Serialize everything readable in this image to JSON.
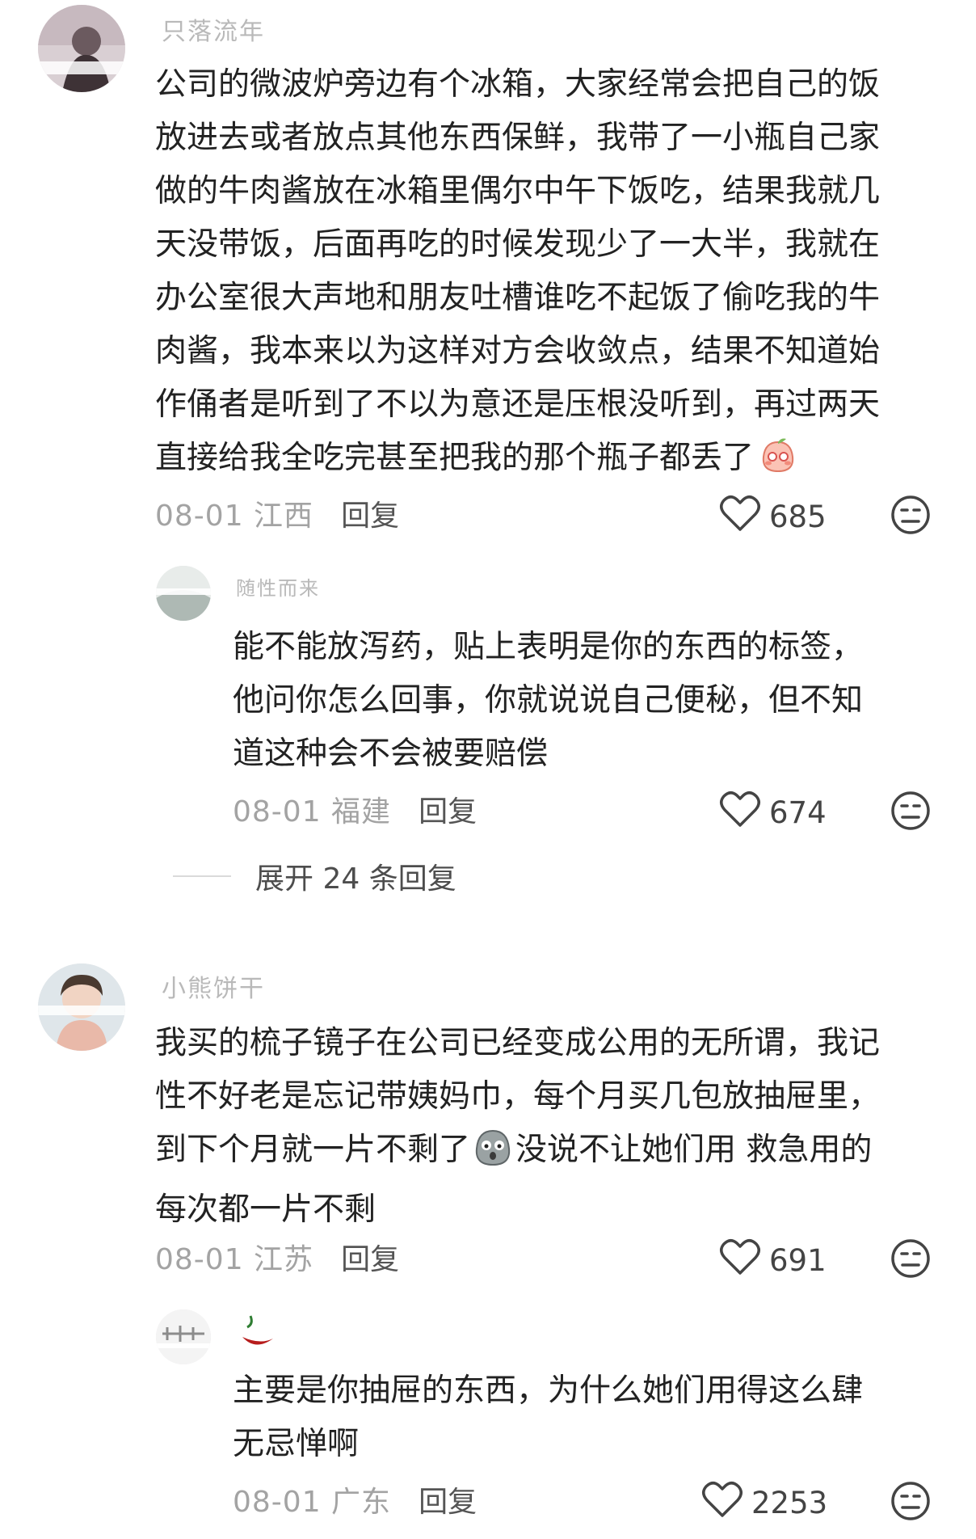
{
  "comments": [
    {
      "author": "只落流年",
      "lines": [
        "公司的微波炉旁边有个冰箱，大家经常会把自己的饭",
        "放进去或者放点其他东西保鲜，我带了一小瓶自己家",
        "做的牛肉酱放在冰箱里偶尔中午下饭吃，结果我就几",
        "天没带饭，后面再吃的时候发现少了一大半，我就在",
        "办公室很大声地和朋友吐槽谁吃不起饭了偷吃我的牛",
        "肉酱，我本来以为这样对方会收敛点，结果不知道始",
        "作俑者是听到了不以为意还是压根没听到，再过两天",
        "直接给我全吃完甚至把我的那个瓶子都丢了"
      ],
      "date_location": "08-01 江西",
      "reply_label": "回复",
      "likes": "685"
    },
    {
      "author": "随性而来",
      "lines": [
        "能不能放泻药，贴上表明是你的东西的标签，",
        "他问你怎么回事，你就说说自己便秘，但不知",
        "道这种会不会被要赔偿"
      ],
      "date_location": "08-01 福建",
      "reply_label": "回复",
      "likes": "674"
    },
    {
      "author": "小熊饼干",
      "lines": [
        "我买的梳子镜子在公司已经变成公用的无所谓，我记",
        "性不好老是忘记带姨妈巾，每个月买几包放抽屉里，",
        "到下个月就一片不剩了",
        "每次都一片不剩"
      ],
      "line3_tail": "没说不让她们用 救急用的",
      "date_location": "08-01 江苏",
      "reply_label": "回复",
      "likes": "691"
    },
    {
      "author": "",
      "lines": [
        "主要是你抽屉的东西，为什么她们用得这么肆",
        "无忌惮啊"
      ],
      "date_location": "08-01 广东",
      "reply_label": "回复",
      "likes": "2253"
    }
  ],
  "expand_replies": "展开 24 条回复",
  "icons": {
    "like": "heart-outline-icon",
    "dislike": "neutral-face-icon",
    "emoji1": "blushing-peach-emoji",
    "emoji2": "shocked-face-emoji"
  }
}
